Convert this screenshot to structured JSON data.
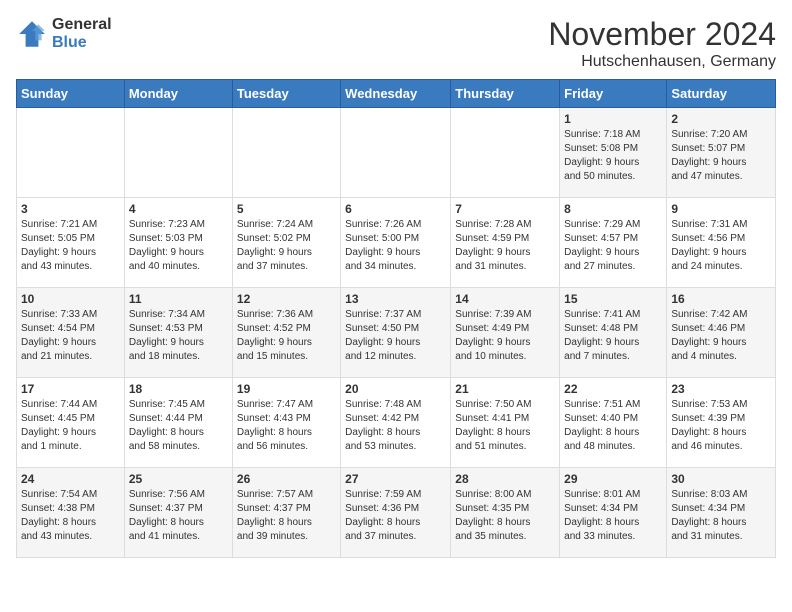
{
  "logo": {
    "general": "General",
    "blue": "Blue"
  },
  "title": "November 2024",
  "location": "Hutschenhausen, Germany",
  "weekdays": [
    "Sunday",
    "Monday",
    "Tuesday",
    "Wednesday",
    "Thursday",
    "Friday",
    "Saturday"
  ],
  "weeks": [
    [
      {
        "day": "",
        "info": ""
      },
      {
        "day": "",
        "info": ""
      },
      {
        "day": "",
        "info": ""
      },
      {
        "day": "",
        "info": ""
      },
      {
        "day": "",
        "info": ""
      },
      {
        "day": "1",
        "info": "Sunrise: 7:18 AM\nSunset: 5:08 PM\nDaylight: 9 hours\nand 50 minutes."
      },
      {
        "day": "2",
        "info": "Sunrise: 7:20 AM\nSunset: 5:07 PM\nDaylight: 9 hours\nand 47 minutes."
      }
    ],
    [
      {
        "day": "3",
        "info": "Sunrise: 7:21 AM\nSunset: 5:05 PM\nDaylight: 9 hours\nand 43 minutes."
      },
      {
        "day": "4",
        "info": "Sunrise: 7:23 AM\nSunset: 5:03 PM\nDaylight: 9 hours\nand 40 minutes."
      },
      {
        "day": "5",
        "info": "Sunrise: 7:24 AM\nSunset: 5:02 PM\nDaylight: 9 hours\nand 37 minutes."
      },
      {
        "day": "6",
        "info": "Sunrise: 7:26 AM\nSunset: 5:00 PM\nDaylight: 9 hours\nand 34 minutes."
      },
      {
        "day": "7",
        "info": "Sunrise: 7:28 AM\nSunset: 4:59 PM\nDaylight: 9 hours\nand 31 minutes."
      },
      {
        "day": "8",
        "info": "Sunrise: 7:29 AM\nSunset: 4:57 PM\nDaylight: 9 hours\nand 27 minutes."
      },
      {
        "day": "9",
        "info": "Sunrise: 7:31 AM\nSunset: 4:56 PM\nDaylight: 9 hours\nand 24 minutes."
      }
    ],
    [
      {
        "day": "10",
        "info": "Sunrise: 7:33 AM\nSunset: 4:54 PM\nDaylight: 9 hours\nand 21 minutes."
      },
      {
        "day": "11",
        "info": "Sunrise: 7:34 AM\nSunset: 4:53 PM\nDaylight: 9 hours\nand 18 minutes."
      },
      {
        "day": "12",
        "info": "Sunrise: 7:36 AM\nSunset: 4:52 PM\nDaylight: 9 hours\nand 15 minutes."
      },
      {
        "day": "13",
        "info": "Sunrise: 7:37 AM\nSunset: 4:50 PM\nDaylight: 9 hours\nand 12 minutes."
      },
      {
        "day": "14",
        "info": "Sunrise: 7:39 AM\nSunset: 4:49 PM\nDaylight: 9 hours\nand 10 minutes."
      },
      {
        "day": "15",
        "info": "Sunrise: 7:41 AM\nSunset: 4:48 PM\nDaylight: 9 hours\nand 7 minutes."
      },
      {
        "day": "16",
        "info": "Sunrise: 7:42 AM\nSunset: 4:46 PM\nDaylight: 9 hours\nand 4 minutes."
      }
    ],
    [
      {
        "day": "17",
        "info": "Sunrise: 7:44 AM\nSunset: 4:45 PM\nDaylight: 9 hours\nand 1 minute."
      },
      {
        "day": "18",
        "info": "Sunrise: 7:45 AM\nSunset: 4:44 PM\nDaylight: 8 hours\nand 58 minutes."
      },
      {
        "day": "19",
        "info": "Sunrise: 7:47 AM\nSunset: 4:43 PM\nDaylight: 8 hours\nand 56 minutes."
      },
      {
        "day": "20",
        "info": "Sunrise: 7:48 AM\nSunset: 4:42 PM\nDaylight: 8 hours\nand 53 minutes."
      },
      {
        "day": "21",
        "info": "Sunrise: 7:50 AM\nSunset: 4:41 PM\nDaylight: 8 hours\nand 51 minutes."
      },
      {
        "day": "22",
        "info": "Sunrise: 7:51 AM\nSunset: 4:40 PM\nDaylight: 8 hours\nand 48 minutes."
      },
      {
        "day": "23",
        "info": "Sunrise: 7:53 AM\nSunset: 4:39 PM\nDaylight: 8 hours\nand 46 minutes."
      }
    ],
    [
      {
        "day": "24",
        "info": "Sunrise: 7:54 AM\nSunset: 4:38 PM\nDaylight: 8 hours\nand 43 minutes."
      },
      {
        "day": "25",
        "info": "Sunrise: 7:56 AM\nSunset: 4:37 PM\nDaylight: 8 hours\nand 41 minutes."
      },
      {
        "day": "26",
        "info": "Sunrise: 7:57 AM\nSunset: 4:37 PM\nDaylight: 8 hours\nand 39 minutes."
      },
      {
        "day": "27",
        "info": "Sunrise: 7:59 AM\nSunset: 4:36 PM\nDaylight: 8 hours\nand 37 minutes."
      },
      {
        "day": "28",
        "info": "Sunrise: 8:00 AM\nSunset: 4:35 PM\nDaylight: 8 hours\nand 35 minutes."
      },
      {
        "day": "29",
        "info": "Sunrise: 8:01 AM\nSunset: 4:34 PM\nDaylight: 8 hours\nand 33 minutes."
      },
      {
        "day": "30",
        "info": "Sunrise: 8:03 AM\nSunset: 4:34 PM\nDaylight: 8 hours\nand 31 minutes."
      }
    ]
  ]
}
